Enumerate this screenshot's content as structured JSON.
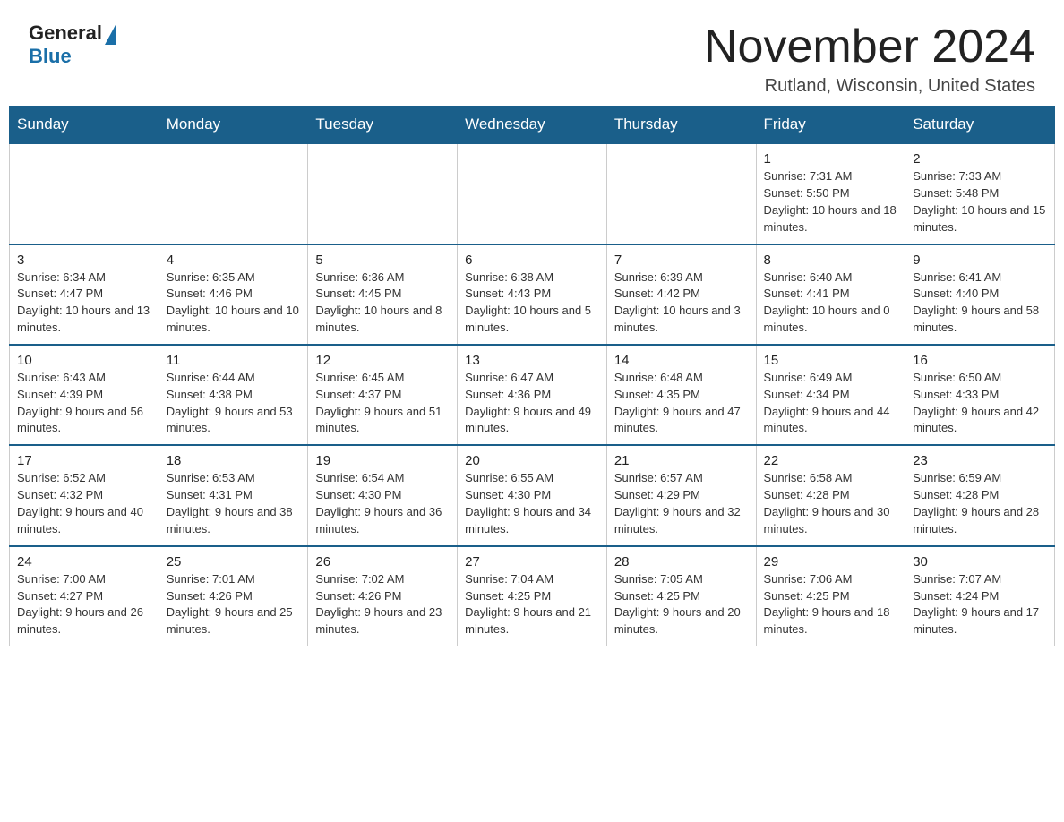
{
  "header": {
    "logo_general": "General",
    "logo_blue": "Blue",
    "month_title": "November 2024",
    "location": "Rutland, Wisconsin, United States"
  },
  "days_of_week": [
    "Sunday",
    "Monday",
    "Tuesday",
    "Wednesday",
    "Thursday",
    "Friday",
    "Saturday"
  ],
  "weeks": [
    [
      {
        "day": "",
        "info": "",
        "empty": true
      },
      {
        "day": "",
        "info": "",
        "empty": true
      },
      {
        "day": "",
        "info": "",
        "empty": true
      },
      {
        "day": "",
        "info": "",
        "empty": true
      },
      {
        "day": "",
        "info": "",
        "empty": true
      },
      {
        "day": "1",
        "info": "Sunrise: 7:31 AM\nSunset: 5:50 PM\nDaylight: 10 hours and 18 minutes."
      },
      {
        "day": "2",
        "info": "Sunrise: 7:33 AM\nSunset: 5:48 PM\nDaylight: 10 hours and 15 minutes."
      }
    ],
    [
      {
        "day": "3",
        "info": "Sunrise: 6:34 AM\nSunset: 4:47 PM\nDaylight: 10 hours and 13 minutes."
      },
      {
        "day": "4",
        "info": "Sunrise: 6:35 AM\nSunset: 4:46 PM\nDaylight: 10 hours and 10 minutes."
      },
      {
        "day": "5",
        "info": "Sunrise: 6:36 AM\nSunset: 4:45 PM\nDaylight: 10 hours and 8 minutes."
      },
      {
        "day": "6",
        "info": "Sunrise: 6:38 AM\nSunset: 4:43 PM\nDaylight: 10 hours and 5 minutes."
      },
      {
        "day": "7",
        "info": "Sunrise: 6:39 AM\nSunset: 4:42 PM\nDaylight: 10 hours and 3 minutes."
      },
      {
        "day": "8",
        "info": "Sunrise: 6:40 AM\nSunset: 4:41 PM\nDaylight: 10 hours and 0 minutes."
      },
      {
        "day": "9",
        "info": "Sunrise: 6:41 AM\nSunset: 4:40 PM\nDaylight: 9 hours and 58 minutes."
      }
    ],
    [
      {
        "day": "10",
        "info": "Sunrise: 6:43 AM\nSunset: 4:39 PM\nDaylight: 9 hours and 56 minutes."
      },
      {
        "day": "11",
        "info": "Sunrise: 6:44 AM\nSunset: 4:38 PM\nDaylight: 9 hours and 53 minutes."
      },
      {
        "day": "12",
        "info": "Sunrise: 6:45 AM\nSunset: 4:37 PM\nDaylight: 9 hours and 51 minutes."
      },
      {
        "day": "13",
        "info": "Sunrise: 6:47 AM\nSunset: 4:36 PM\nDaylight: 9 hours and 49 minutes."
      },
      {
        "day": "14",
        "info": "Sunrise: 6:48 AM\nSunset: 4:35 PM\nDaylight: 9 hours and 47 minutes."
      },
      {
        "day": "15",
        "info": "Sunrise: 6:49 AM\nSunset: 4:34 PM\nDaylight: 9 hours and 44 minutes."
      },
      {
        "day": "16",
        "info": "Sunrise: 6:50 AM\nSunset: 4:33 PM\nDaylight: 9 hours and 42 minutes."
      }
    ],
    [
      {
        "day": "17",
        "info": "Sunrise: 6:52 AM\nSunset: 4:32 PM\nDaylight: 9 hours and 40 minutes."
      },
      {
        "day": "18",
        "info": "Sunrise: 6:53 AM\nSunset: 4:31 PM\nDaylight: 9 hours and 38 minutes."
      },
      {
        "day": "19",
        "info": "Sunrise: 6:54 AM\nSunset: 4:30 PM\nDaylight: 9 hours and 36 minutes."
      },
      {
        "day": "20",
        "info": "Sunrise: 6:55 AM\nSunset: 4:30 PM\nDaylight: 9 hours and 34 minutes."
      },
      {
        "day": "21",
        "info": "Sunrise: 6:57 AM\nSunset: 4:29 PM\nDaylight: 9 hours and 32 minutes."
      },
      {
        "day": "22",
        "info": "Sunrise: 6:58 AM\nSunset: 4:28 PM\nDaylight: 9 hours and 30 minutes."
      },
      {
        "day": "23",
        "info": "Sunrise: 6:59 AM\nSunset: 4:28 PM\nDaylight: 9 hours and 28 minutes."
      }
    ],
    [
      {
        "day": "24",
        "info": "Sunrise: 7:00 AM\nSunset: 4:27 PM\nDaylight: 9 hours and 26 minutes."
      },
      {
        "day": "25",
        "info": "Sunrise: 7:01 AM\nSunset: 4:26 PM\nDaylight: 9 hours and 25 minutes."
      },
      {
        "day": "26",
        "info": "Sunrise: 7:02 AM\nSunset: 4:26 PM\nDaylight: 9 hours and 23 minutes."
      },
      {
        "day": "27",
        "info": "Sunrise: 7:04 AM\nSunset: 4:25 PM\nDaylight: 9 hours and 21 minutes."
      },
      {
        "day": "28",
        "info": "Sunrise: 7:05 AM\nSunset: 4:25 PM\nDaylight: 9 hours and 20 minutes."
      },
      {
        "day": "29",
        "info": "Sunrise: 7:06 AM\nSunset: 4:25 PM\nDaylight: 9 hours and 18 minutes."
      },
      {
        "day": "30",
        "info": "Sunrise: 7:07 AM\nSunset: 4:24 PM\nDaylight: 9 hours and 17 minutes."
      }
    ]
  ]
}
